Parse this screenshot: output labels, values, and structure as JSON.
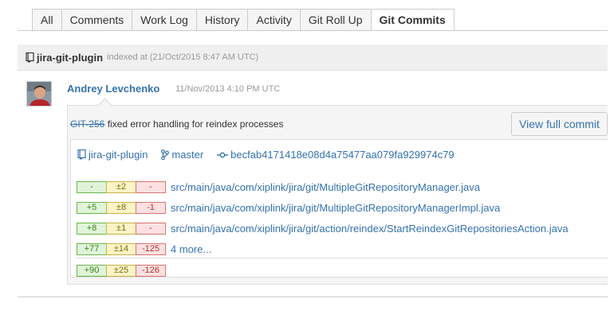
{
  "tabs": [
    {
      "label": "All",
      "active": false
    },
    {
      "label": "Comments",
      "active": false
    },
    {
      "label": "Work Log",
      "active": false
    },
    {
      "label": "History",
      "active": false
    },
    {
      "label": "Activity",
      "active": false
    },
    {
      "label": "Git Roll Up",
      "active": false
    },
    {
      "label": "Git Commits",
      "active": true
    }
  ],
  "repo_header": {
    "name": "jira-git-plugin",
    "indexed": "indexed at (21/Oct/2015 8:47 AM UTC)",
    "icon": "repository-icon"
  },
  "commit": {
    "author": "Andrey Levchenko",
    "date": "11/Nov/2013 4:10 PM UTC",
    "issue_key": "GIT-256",
    "message": " fixed error handling for reindex processes",
    "view_button": "View full commit",
    "repository": "jira-git-plugin",
    "branch": "master",
    "hash": "becfab4171418e08d4a75477aa079fa929974c79",
    "files": [
      {
        "added": "-",
        "modified": "±2",
        "deleted": "-",
        "path": "src/main/java/com/xiplink/jira/git/MultipleGitRepositoryManager.java"
      },
      {
        "added": "+5",
        "modified": "±8",
        "deleted": "-1",
        "path": "src/main/java/com/xiplink/jira/git/MultipleGitRepositoryManagerImpl.java"
      },
      {
        "added": "+8",
        "modified": "±1",
        "deleted": "-",
        "path": "src/main/java/com/xiplink/jira/git/action/reindex/StartReindexGitRepositoriesAction.java"
      },
      {
        "added": "+77",
        "modified": "±14",
        "deleted": "-125",
        "path": "4 more..."
      }
    ],
    "totals": {
      "added": "+90",
      "modified": "±25",
      "deleted": "-126"
    }
  },
  "colors": {
    "link": "#3572b0",
    "added_bg": "#dff4d9",
    "modified_bg": "#fbf4c6",
    "deleted_bg": "#fbe1e1"
  }
}
